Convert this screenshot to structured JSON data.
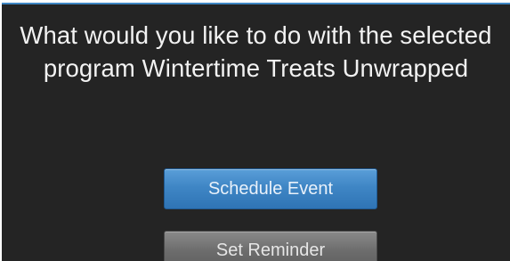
{
  "dialog": {
    "message": "What would you like to do with the selected program Wintertime Treats Unwrapped",
    "buttons": {
      "schedule_event": "Schedule Event",
      "set_reminder": "Set Reminder"
    }
  },
  "colors": {
    "background": "#242424",
    "accent": "#3f86c4",
    "primary_button": "#3f86c5",
    "secondary_button": "#6c6c6c",
    "text": "#f2f2f2"
  }
}
